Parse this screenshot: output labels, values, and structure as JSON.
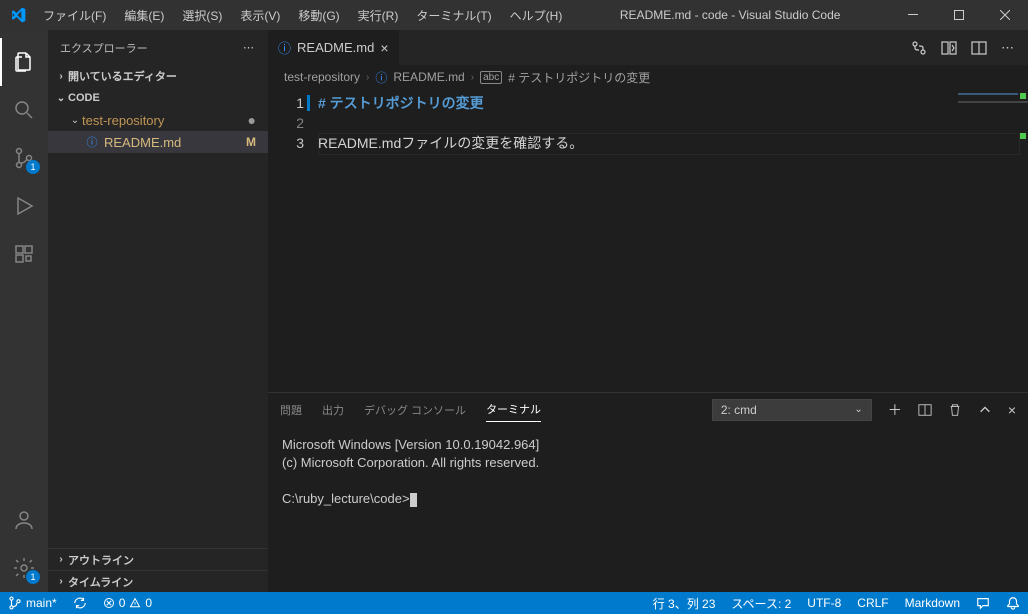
{
  "titlebar": {
    "menus": [
      "ファイル(F)",
      "編集(E)",
      "選択(S)",
      "表示(V)",
      "移動(G)",
      "実行(R)",
      "ターミナル(T)",
      "ヘルプ(H)"
    ],
    "title": "README.md - code - Visual Studio Code"
  },
  "activitybar": {
    "scm_badge": "1",
    "settings_badge": "1"
  },
  "sidebar": {
    "title": "エクスプローラー",
    "open_editors": "開いているエディター",
    "workspace": "CODE",
    "folder": "test-repository",
    "file": "README.md",
    "file_mod": "M",
    "outline": "アウトライン",
    "timeline": "タイムライン"
  },
  "tab": {
    "label": "README.md"
  },
  "breadcrumbs": {
    "a": "test-repository",
    "b": "README.md",
    "c": "# テストリポジトリの変更"
  },
  "code": {
    "ln1": "1",
    "ln2": "2",
    "ln3": "3",
    "line1": "# テストリポジトリの変更",
    "line3": "README.mdファイルの変更を確認する。"
  },
  "panel": {
    "tabs": {
      "problems": "問題",
      "output": "出力",
      "debug": "デバッグ コンソール",
      "terminal": "ターミナル"
    },
    "term_select": "2: cmd",
    "terminal_lines": [
      "Microsoft Windows [Version 10.0.19042.964]",
      "(c) Microsoft Corporation. All rights reserved.",
      "",
      "C:\\ruby_lecture\\code>"
    ]
  },
  "status": {
    "branch": "main*",
    "errors": "0",
    "warnings": "0",
    "cursor": "行 3、列 23",
    "spaces": "スペース: 2",
    "encoding": "UTF-8",
    "eol": "CRLF",
    "lang": "Markdown"
  }
}
